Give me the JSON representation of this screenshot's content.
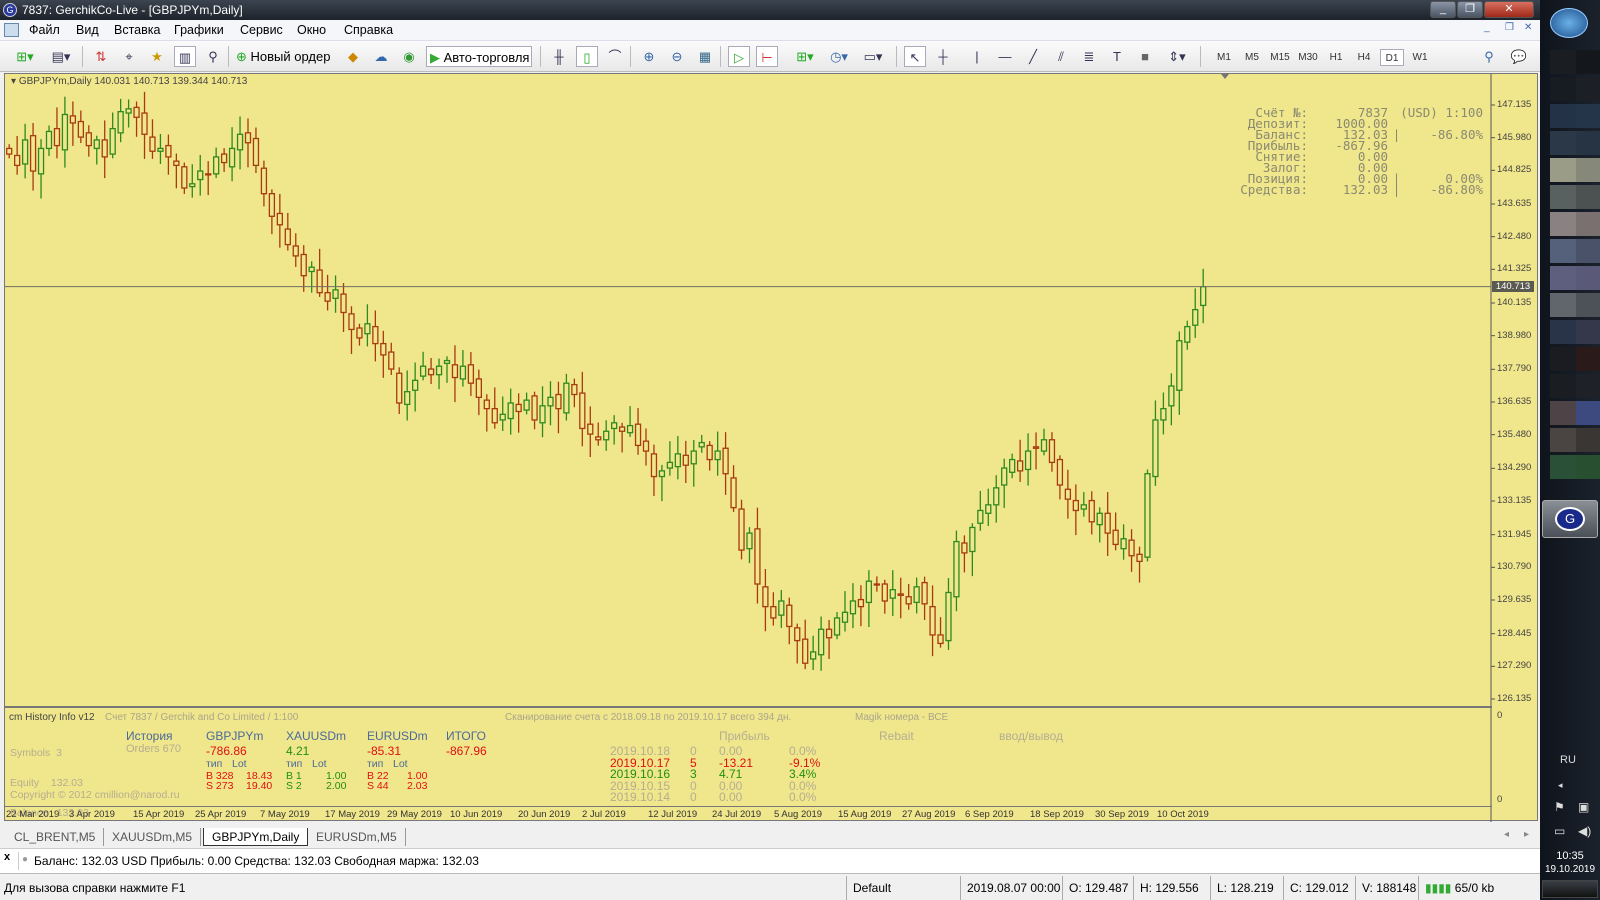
{
  "window": {
    "title": "7837: GerchikCo-Live - [GBPJPYm,Daily]",
    "buttons": [
      "_",
      "❐",
      "✕"
    ],
    "mdi_buttons": [
      "_",
      "❐",
      "✕"
    ]
  },
  "menu": [
    "Файл",
    "Вид",
    "Вставка",
    "Графики",
    "Сервис",
    "Окно",
    "Справка"
  ],
  "toolbar": {
    "new_order": "Новый ордер",
    "autotrading": "Авто-торговля",
    "timeframes": [
      "M1",
      "M5",
      "M15",
      "M30",
      "H1",
      "H4",
      "D1",
      "W1"
    ],
    "active_timeframe": "D1"
  },
  "chart": {
    "header": "GBPJPYm,Daily  140.031 140.713 139.344 140.713",
    "account": [
      {
        "label": "Счёт №:",
        "value": "7837",
        "extra": "(USD) 1:100"
      },
      {
        "label": "Депозит:",
        "value": "1000.00",
        "extra": ""
      },
      {
        "label": "Баланс:",
        "value": "132.03",
        "extra": "|    -86.80%"
      },
      {
        "label": "Прибыль:",
        "value": "-867.96",
        "extra": ""
      },
      {
        "label": "Снятие:",
        "value": "0.00",
        "extra": ""
      },
      {
        "label": "Залог:",
        "value": "0.00",
        "extra": ""
      },
      {
        "label": "Позиция:",
        "value": "0.00",
        "extra": "|      0.00%"
      },
      {
        "label": "Средства:",
        "value": "132.03",
        "extra": "|    -86.80%"
      }
    ],
    "current_price": "140.713",
    "colors": {
      "background": "#f0e68c",
      "up": "#2e8a1e",
      "down": "#a83a10",
      "price_line": "#707060"
    }
  },
  "chart_data": {
    "type": "candlestick",
    "symbol": "GBPJPYm",
    "timeframe": "Daily",
    "ylim": [
      126.135,
      147.135
    ],
    "y_ticks": [
      "147.135",
      "145.980",
      "144.825",
      "143.635",
      "142.480",
      "141.325",
      "140.135",
      "138.980",
      "137.790",
      "136.635",
      "135.480",
      "134.290",
      "133.135",
      "131.945",
      "130.790",
      "129.635",
      "128.445",
      "127.290",
      "126.135"
    ],
    "x_ticks": [
      "22 Mar 2019",
      "3 Apr 2019",
      "15 Apr 2019",
      "25 Apr 2019",
      "7 May 2019",
      "17 May 2019",
      "29 May 2019",
      "10 Jun 2019",
      "20 Jun 2019",
      "2 Jul 2019",
      "12 Jul 2019",
      "24 Jul 2019",
      "5 Aug 2019",
      "15 Aug 2019",
      "27 Aug 2019",
      "6 Sep 2019",
      "18 Sep 2019",
      "30 Sep 2019",
      "10 Oct 2019"
    ],
    "close": [
      145.4,
      145.0,
      145.9,
      144.8,
      145.6,
      146.2,
      145.7,
      146.8,
      146.5,
      146.0,
      145.7,
      145.9,
      145.3,
      146.3,
      146.9,
      147.0,
      146.7,
      146.1,
      145.5,
      145.6,
      145.3,
      145.0,
      144.2,
      144.35,
      144.8,
      144.7,
      145.3,
      145.1,
      145.6,
      146.1,
      145.8,
      145.0,
      144.0,
      143.2,
      142.9,
      142.2,
      141.8,
      141.1,
      141.4,
      140.5,
      140.2,
      140.6,
      139.8,
      139.2,
      138.9,
      139.4,
      138.7,
      138.3,
      137.8,
      136.6,
      137.0,
      137.4,
      137.9,
      137.6,
      137.9,
      138.1,
      137.5,
      137.9,
      137.3,
      136.8,
      136.4,
      135.9,
      136.2,
      136.6,
      136.3,
      136.7,
      136.0,
      136.5,
      136.8,
      136.4,
      137.3,
      136.9,
      135.7,
      135.5,
      135.3,
      135.6,
      135.9,
      135.6,
      135.8,
      135.1,
      134.9,
      134.0,
      134.2,
      134.5,
      134.8,
      134.4,
      134.9,
      135.2,
      134.6,
      134.9,
      134.1,
      132.9,
      131.4,
      132.0,
      130.2,
      129.4,
      129.0,
      129.6,
      128.7,
      128.2,
      127.4,
      127.8,
      128.6,
      128.3,
      129.0,
      129.2,
      129.6,
      129.4,
      130.3,
      130.2,
      129.6,
      130.0,
      129.8,
      129.5,
      130.1,
      129.5,
      128.4,
      128.1,
      129.9,
      131.7,
      131.3,
      132.2,
      132.8,
      133.0,
      133.6,
      134.3,
      134.6,
      134.2,
      134.9,
      135.0,
      135.3,
      134.5,
      133.7,
      133.2,
      132.8,
      133.0,
      132.4,
      132.7,
      132.0,
      131.6,
      131.8,
      131.2,
      131.0,
      134.1,
      136.0,
      136.4,
      137.2,
      138.8,
      139.3,
      139.9,
      140.713
    ]
  },
  "indicator": {
    "name": "cm History Info v12",
    "account_line": "Счет 7837 / Gerchik and Co Limited / 1:100",
    "scan_line": "Сканирование счета с 2018.09.18 по 2019.10.17 всего 394 дн.",
    "magic_line": "Magik номера - ВСЕ",
    "summary": [
      "Symbols  3",
      "Equity    132.03",
      "Balance   132.03",
      "FreeMar.  132.03"
    ],
    "history_label": "История",
    "orders": "Orders 670",
    "symbols": [
      {
        "name": "GBPJPYm",
        "profit": "-786.86",
        "color": "r",
        "type_hdr": "тип",
        "lot_hdr": "Lot",
        "b": "B 328",
        "b_lot": "18.43",
        "s": "S 273",
        "s_lot": "19.40"
      },
      {
        "name": "XAUUSDm",
        "profit": "4.21",
        "color": "gr",
        "type_hdr": "тип",
        "lot_hdr": "Lot",
        "b": "B 1",
        "b_lot": "1.00",
        "s": "S 2",
        "s_lot": "2.00"
      },
      {
        "name": "EURUSDm",
        "profit": "-85.31",
        "color": "r",
        "type_hdr": "тип",
        "lot_hdr": "Lot",
        "b": "B 22",
        "b_lot": "1.00",
        "s": "S 44",
        "s_lot": "2.03"
      }
    ],
    "total_label": "ИТОГО",
    "total": "-867.96",
    "col_headers": [
      "Прибыль",
      "Rebait",
      "ввод/вывод"
    ],
    "days": [
      {
        "date": "2019.10.18",
        "n": "0",
        "profit": "0.00",
        "pct": "0.0%",
        "c": "gl"
      },
      {
        "date": "2019.10.17",
        "n": "5",
        "profit": "-13.21",
        "pct": "-9.1%",
        "c": "r"
      },
      {
        "date": "2019.10.16",
        "n": "3",
        "profit": "4.71",
        "pct": "3.4%",
        "c": "gr"
      },
      {
        "date": "2019.10.15",
        "n": "0",
        "profit": "0.00",
        "pct": "0.0%",
        "c": "gl"
      },
      {
        "date": "2019.10.14",
        "n": "0",
        "profit": "0.00",
        "pct": "0.0%",
        "c": "gl"
      }
    ],
    "copyright": "Copyright © 2012 cmillion@narod.ru",
    "axis": [
      "0",
      "0"
    ]
  },
  "tabs": [
    "CL_BRENT,M5",
    "XAUUSDm,M5",
    "GBPJPYm,Daily",
    "EURUSDm,M5"
  ],
  "active_tab": "GBPJPYm,Daily",
  "terminal": {
    "close": "x",
    "text": "Баланс: 132.03 USD  Прибыль: 0.00  Средства: 132.03  Свободная маржа: 132.03"
  },
  "status": {
    "help": "Для вызова справки нажмите F1",
    "profile": "Default",
    "datetime": "2019.08.07 00:00",
    "open": "O: 129.487",
    "high": "H: 129.556",
    "low": "L: 128.219",
    "close": "C: 129.012",
    "volume": "V: 188148",
    "traffic": "65/0 kb"
  },
  "taskbar": {
    "lang": "RU",
    "time": "10:35",
    "date": "19.10.2019"
  }
}
